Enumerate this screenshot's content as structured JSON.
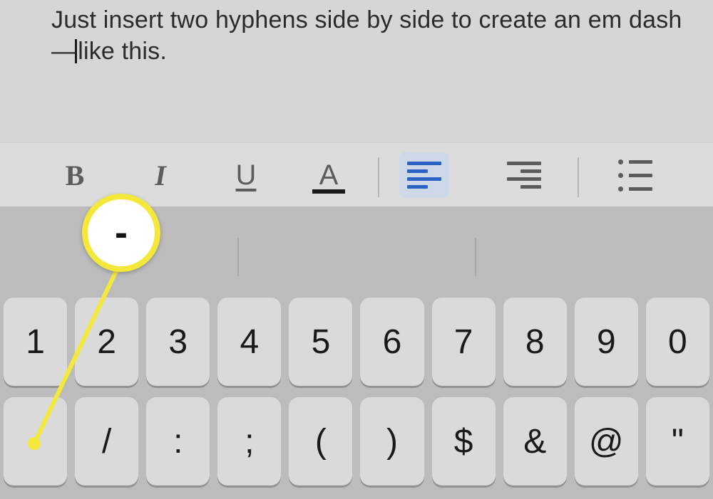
{
  "editor": {
    "text_before_caret": "Just insert two hyphens side by side to create an em dash —",
    "text_after_caret": "like this."
  },
  "toolbar": {
    "bold": {
      "letter": "B"
    },
    "italic": {
      "letter": "I"
    },
    "underline": {
      "letter": "U"
    },
    "text_color": {
      "letter": "A"
    }
  },
  "callout": {
    "symbol": "-"
  },
  "keyboard": {
    "row1": [
      "1",
      "2",
      "3",
      "4",
      "5",
      "6",
      "7",
      "8",
      "9",
      "0"
    ],
    "row2": [
      "-",
      "/",
      ":",
      ";",
      "(",
      ")",
      "$",
      "&",
      "@",
      "\""
    ]
  }
}
